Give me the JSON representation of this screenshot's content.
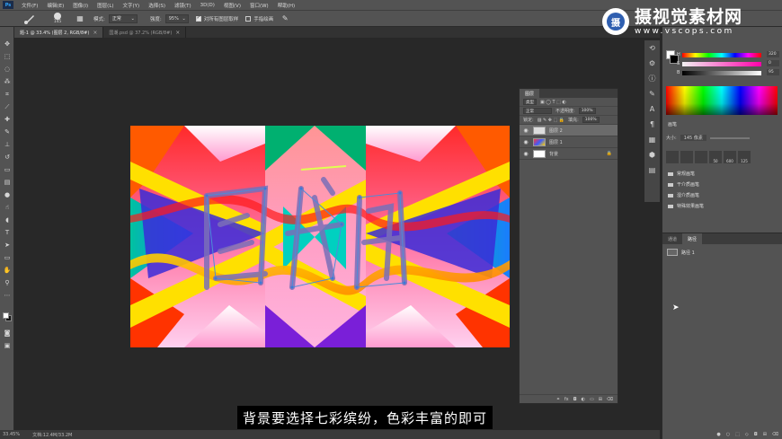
{
  "app": {
    "logo": "Ps"
  },
  "menu": [
    "文件(F)",
    "编辑(E)",
    "图像(I)",
    "图层(L)",
    "文字(Y)",
    "选择(S)",
    "滤镜(T)",
    "3D(D)",
    "视图(V)",
    "窗口(W)",
    "帮助(H)"
  ],
  "options": {
    "brush_size": "145",
    "mode_label": "模式:",
    "mode_value": "正常",
    "opacity_label": "强度:",
    "opacity_value": "95%",
    "sample_all_label": "对所有图层取样",
    "finger_label": "手指绘画"
  },
  "tabs": [
    {
      "label": "题-1 @ 33.4% (图层 2, RGB/8#)",
      "active": true,
      "close": "×"
    },
    {
      "label": "国潮.psd @ 37.2% (RGB/8#)",
      "active": false,
      "close": "×"
    }
  ],
  "status": {
    "zoom": "33.45%",
    "doc": "文档:12.4M/33.2M"
  },
  "brand": {
    "name": "摄视觉素材网",
    "url": "www.vscops.com",
    "logo_char": "摄"
  },
  "color_panel": {
    "h_label": "H",
    "s_label": "S",
    "b_label": "B",
    "h_value": "320",
    "s_value": "0",
    "b_value": "95"
  },
  "brush_panel": {
    "tab": "画笔",
    "size_label": "大小:",
    "size_value": "145 像素",
    "tips": [
      "",
      "",
      "",
      "50",
      "600",
      "125"
    ],
    "folders": [
      "常规画笔",
      "干介质画笔",
      "湿介质画笔",
      "特殊效果画笔"
    ]
  },
  "paths_panel": {
    "tabs": [
      "通道",
      "路径"
    ],
    "path_name": "路径 1"
  },
  "layers_panel": {
    "tab": "图层",
    "filter_label": "类型",
    "blend_mode": "正常",
    "opacity_label": "不透明度:",
    "opacity_value": "100%",
    "lock_label": "锁定:",
    "fill_label": "填充:",
    "fill_value": "100%",
    "layers": [
      "图层 2",
      "图层 1",
      "背景"
    ]
  },
  "subtitle": "背景要选择七彩缤纷，色彩丰富的即可",
  "colors": {
    "accent": "#31a8ff",
    "panel": "#535353",
    "canvas_bg": "#282828"
  }
}
